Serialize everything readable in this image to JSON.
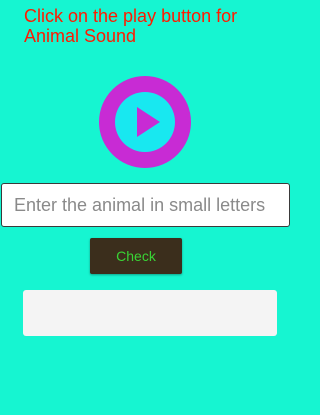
{
  "screen": {
    "instruction": "Click on the play button for Animal Sound"
  },
  "play_button": {
    "icon": "play-icon",
    "outer_color": "#c82bd4",
    "inner_color": "#18e8f0",
    "triangle_color": "#c82bd4"
  },
  "input": {
    "placeholder": "Enter the animal in small letters",
    "value": ""
  },
  "check_button": {
    "label": "Check"
  },
  "result": {
    "text": ""
  },
  "colors": {
    "background": "#16f5d1",
    "instruction_text": "#ff1a00",
    "check_button_bg": "#3b2e1c",
    "check_button_text": "#39d435"
  }
}
